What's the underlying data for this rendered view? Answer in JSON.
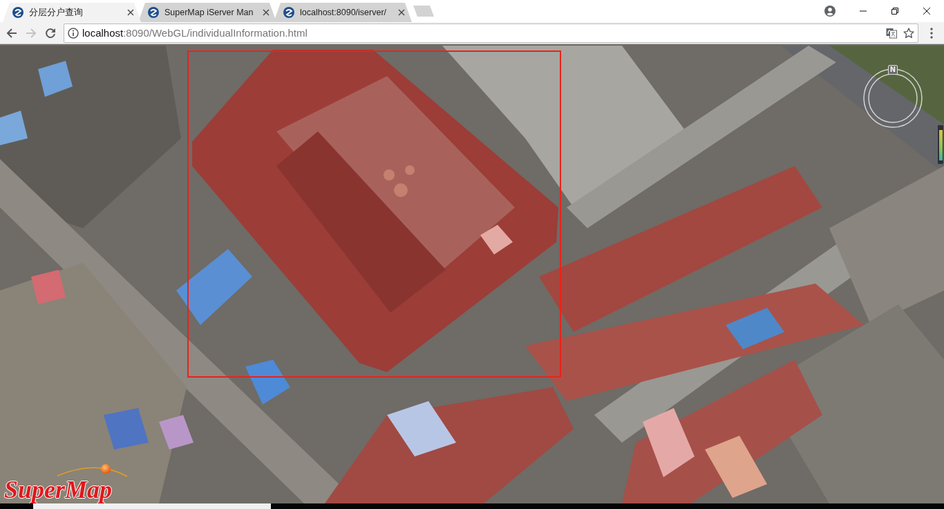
{
  "tabs": [
    {
      "title": "分层分户查询",
      "selected": true
    },
    {
      "title": "SuperMap iServer Man",
      "selected": false
    },
    {
      "title": "localhost:8090/iserver/",
      "selected": false
    }
  ],
  "toolbar": {
    "forward_disabled": true,
    "url": {
      "host": "localhost",
      "rest": ":8090/WebGL/individualInformation.html"
    },
    "bookmarked": false
  },
  "map": {
    "compass": {
      "label": "N"
    },
    "logo": "SuperMap"
  }
}
